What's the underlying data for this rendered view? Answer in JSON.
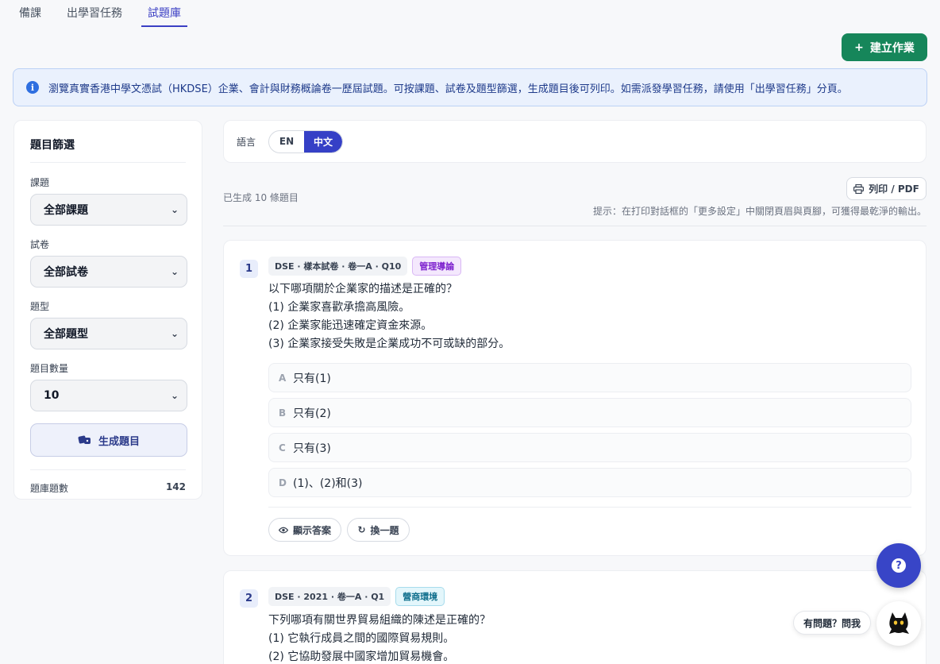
{
  "tabs": [
    {
      "label": "備課"
    },
    {
      "label": "出學習任務"
    },
    {
      "label": "試題庫",
      "active": true
    }
  ],
  "create_button": {
    "label": "建立作業",
    "icon": "plus-icon",
    "color": "#16865a"
  },
  "info_banner": {
    "icon": "info-icon",
    "text": "瀏覽真實香港中學文憑試（HKDSE）企業、會計與財務概論卷一歷屆試題。可按課題、試卷及題型篩選，生成題目後可列印。如需派發學習任務，請使用「出學習任務」分頁。"
  },
  "filters": {
    "title": "題目篩選",
    "topic": {
      "label": "課題",
      "value": "全部課題"
    },
    "paper": {
      "label": "試卷",
      "value": "全部試卷"
    },
    "qtype": {
      "label": "題型",
      "value": "全部題型"
    },
    "count": {
      "label": "題目數量",
      "value": "10"
    },
    "generate_label": "生成題目",
    "bank_label": "題庫題數",
    "bank_count": "142"
  },
  "language": {
    "label": "語言",
    "options": [
      "EN",
      "中文"
    ],
    "selected": "中文"
  },
  "generated_text": "已生成 10 條題目",
  "print_label": "列印 / PDF",
  "print_hint": "提示：在打印對話框的「更多設定」中關閉頁眉與頁腳，可獲得最乾淨的輸出。",
  "questions": [
    {
      "number": "1",
      "source": "DSE · 樣本試卷 · 卷一A · Q10",
      "tag": "管理導論",
      "lines": [
        "以下哪項關於企業家的描述是正確的？",
        "(1) 企業家喜歡承擔高風險。",
        "(2) 企業家能迅速確定資金來源。",
        "(3) 企業家接受失敗是企業成功不可或缺的部分。"
      ],
      "options": [
        {
          "letter": "A",
          "text": "只有(1)"
        },
        {
          "letter": "B",
          "text": "只有(2)"
        },
        {
          "letter": "C",
          "text": "只有(3)"
        },
        {
          "letter": "D",
          "text": "(1)、(2)和(3)"
        }
      ],
      "show_answer": "顯示答案",
      "replace": "換一題"
    },
    {
      "number": "2",
      "source": "DSE · 2021 · 卷一A · Q1",
      "tag": "營商環境",
      "lines": [
        "下列哪項有關世界貿易組織的陳述是正確的？",
        "(1) 它執行成員之間的國際貿易規則。",
        "(2) 它協助發展中國家增加貿易機會。"
      ]
    }
  ],
  "help": {
    "ask_label": "有問題？問我"
  }
}
